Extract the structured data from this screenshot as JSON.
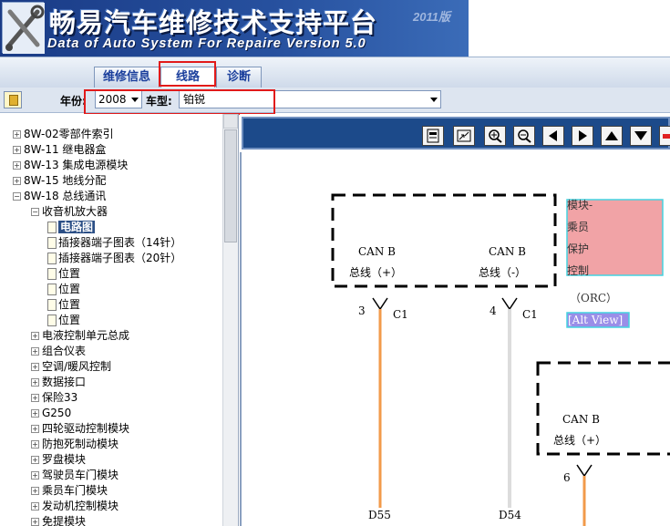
{
  "banner": {
    "title": "畅易汽车维修技术支持平台",
    "version": "2011版",
    "subtitle": "Data of Auto System For Repaire Version 5.0"
  },
  "tabs": [
    {
      "label": "维修信息"
    },
    {
      "label": "线路"
    },
    {
      "label": "诊断"
    }
  ],
  "selectors": {
    "year_label": "年份:",
    "year_value": "2008",
    "model_label": "车型:",
    "model_value": "铂锐"
  },
  "tree": {
    "items": [
      {
        "label": "8W-02零部件索引",
        "level": 0,
        "type": "collapsed"
      },
      {
        "label": "8W-11 继电器盒",
        "level": 0,
        "type": "collapsed"
      },
      {
        "label": "8W-13 集成电源模块",
        "level": 0,
        "type": "collapsed"
      },
      {
        "label": "8W-15 地线分配",
        "level": 0,
        "type": "collapsed"
      },
      {
        "label": "8W-18 总线通讯",
        "level": 0,
        "type": "expanded"
      },
      {
        "label": "收音机放大器",
        "level": 1,
        "type": "expanded"
      },
      {
        "label": "电路图",
        "level": 2,
        "type": "doc",
        "selected": true
      },
      {
        "label": "插接器端子图表（14针）",
        "level": 2,
        "type": "doc"
      },
      {
        "label": "插接器端子图表（20针）",
        "level": 2,
        "type": "doc"
      },
      {
        "label": "位置",
        "level": 2,
        "type": "doc"
      },
      {
        "label": "位置",
        "level": 2,
        "type": "doc"
      },
      {
        "label": "位置",
        "level": 2,
        "type": "doc"
      },
      {
        "label": "位置",
        "level": 2,
        "type": "doc"
      },
      {
        "label": "电液控制单元总成",
        "level": 1,
        "type": "collapsed"
      },
      {
        "label": "组合仪表",
        "level": 1,
        "type": "collapsed"
      },
      {
        "label": "空调/暖风控制",
        "level": 1,
        "type": "collapsed"
      },
      {
        "label": "数据接口",
        "level": 1,
        "type": "collapsed"
      },
      {
        "label": "保险33",
        "level": 1,
        "type": "collapsed"
      },
      {
        "label": "G250",
        "level": 1,
        "type": "collapsed"
      },
      {
        "label": "四轮驱动控制模块",
        "level": 1,
        "type": "collapsed"
      },
      {
        "label": "防抱死制动模块",
        "level": 1,
        "type": "collapsed"
      },
      {
        "label": "罗盘模块",
        "level": 1,
        "type": "collapsed"
      },
      {
        "label": "驾驶员车门模块",
        "level": 1,
        "type": "collapsed"
      },
      {
        "label": "乘员车门模块",
        "level": 1,
        "type": "collapsed"
      },
      {
        "label": "发动机控制模块",
        "level": 1,
        "type": "collapsed"
      },
      {
        "label": "免提模块",
        "level": 1,
        "type": "collapsed"
      }
    ]
  },
  "toolbar_icons": [
    "print-icon",
    "fit-page-icon",
    "zoom-in-icon",
    "zoom-out-icon",
    "arrow-left-icon",
    "arrow-right-icon",
    "arrow-up-icon",
    "arrow-down-icon",
    "stop-icon"
  ],
  "diagram": {
    "box1_label_a": "CAN B",
    "box1_label_b": "总线（+）",
    "box1_label_c": "CAN B",
    "box1_label_d": "总线（-）",
    "module_lines": [
      "模块-",
      "乘员",
      "保护",
      "控制"
    ],
    "orc": "（ORC）",
    "alt_view": "[Alt View]",
    "pin1": "3",
    "conn1": "C1",
    "pin2": "4",
    "conn2": "C1",
    "wire1": "D55",
    "wire2": "D54",
    "box2_label_a": "CAN B",
    "box2_label_b": "总线（+）",
    "pin3": "6",
    "colors": {
      "wire_orange": "#f29a4a",
      "wire_gray": "#dcdcdc",
      "module_fill": "#f1a3a6",
      "module_border": "#45d3e0",
      "alt_fill": "#9a8ee8"
    }
  }
}
